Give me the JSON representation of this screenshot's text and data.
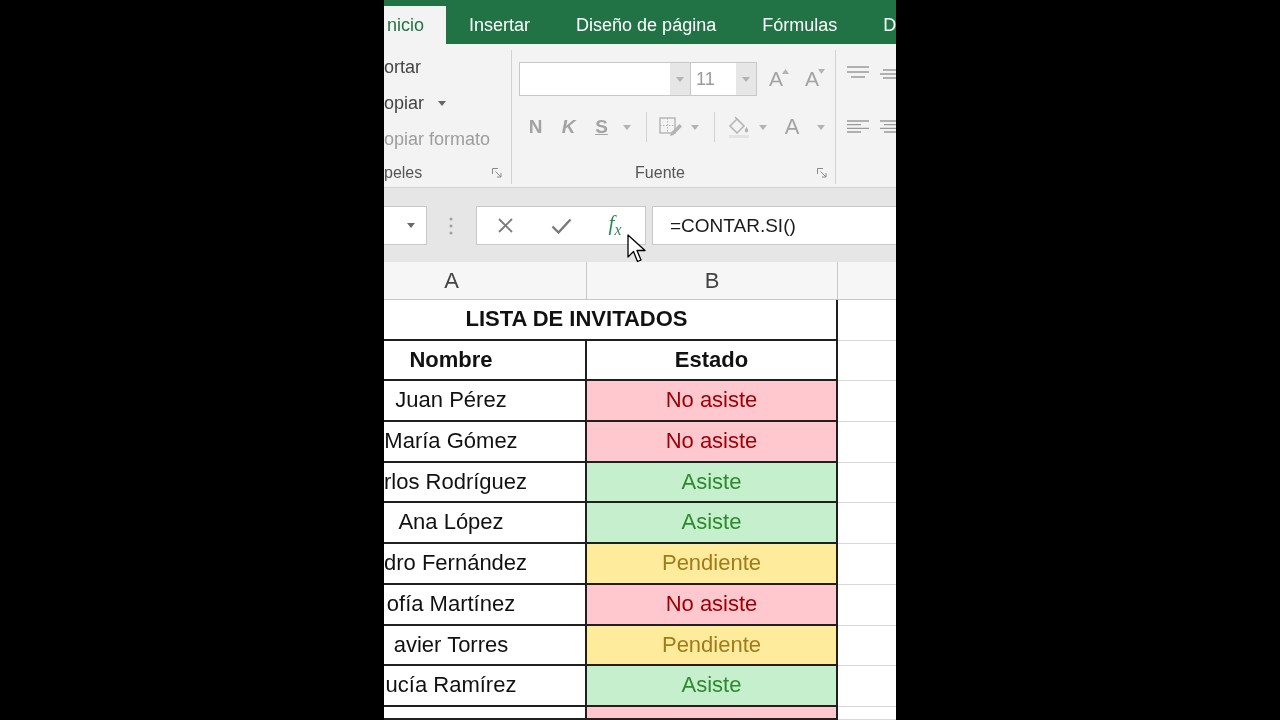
{
  "ribbon_tabs": [
    {
      "label": "nicio",
      "selected": true
    },
    {
      "label": "Insertar",
      "selected": false
    },
    {
      "label": "Diseño de página",
      "selected": false
    },
    {
      "label": "Fórmulas",
      "selected": false
    },
    {
      "label": "D",
      "selected": false
    }
  ],
  "clipboard_group": {
    "items": [
      {
        "label": "ortar",
        "disabled": false,
        "dropdown": false
      },
      {
        "label": "opiar",
        "disabled": false,
        "dropdown": true
      },
      {
        "label": "opiar formato",
        "disabled": true,
        "dropdown": false
      }
    ],
    "label": "peles"
  },
  "font_group": {
    "disabled": true,
    "font_size": "11",
    "size_buttons": [
      {
        "label": "A",
        "kind": "grow"
      },
      {
        "label": "A",
        "kind": "shrink"
      }
    ],
    "style_buttons": [
      {
        "label": "N",
        "kind": "bold"
      },
      {
        "label": "K",
        "kind": "italic"
      },
      {
        "label": "S",
        "kind": "underline"
      }
    ],
    "font_color_button": "A",
    "label": "Fuente"
  },
  "formula_bar": {
    "insert_function": "f$_{x}$",
    "formula": "=CONTAR.SI()"
  },
  "column_headers": [
    "A",
    "B"
  ],
  "sheet": {
    "title": "LISTA DE INVITADOS",
    "headers": [
      "Nombre",
      "Estado"
    ],
    "rows": [
      {
        "name": "Juan Pérez",
        "status": "No asiste",
        "kind": "declined"
      },
      {
        "name": "María Gómez",
        "status": "No asiste",
        "kind": "declined"
      },
      {
        "name": "rlos Rodríguez",
        "status": "Asiste",
        "kind": "attending"
      },
      {
        "name": "Ana López",
        "status": "Asiste",
        "kind": "attending"
      },
      {
        "name": "dro Fernández",
        "status": "Pendiente",
        "kind": "pending"
      },
      {
        "name": "ofía Martínez",
        "status": "No asiste",
        "kind": "declined"
      },
      {
        "name": "avier Torres",
        "status": "Pendiente",
        "kind": "pending"
      },
      {
        "name": "ucía Ramírez",
        "status": "Asiste",
        "kind": "attending"
      },
      {
        "kind": "declined"
      }
    ]
  }
}
